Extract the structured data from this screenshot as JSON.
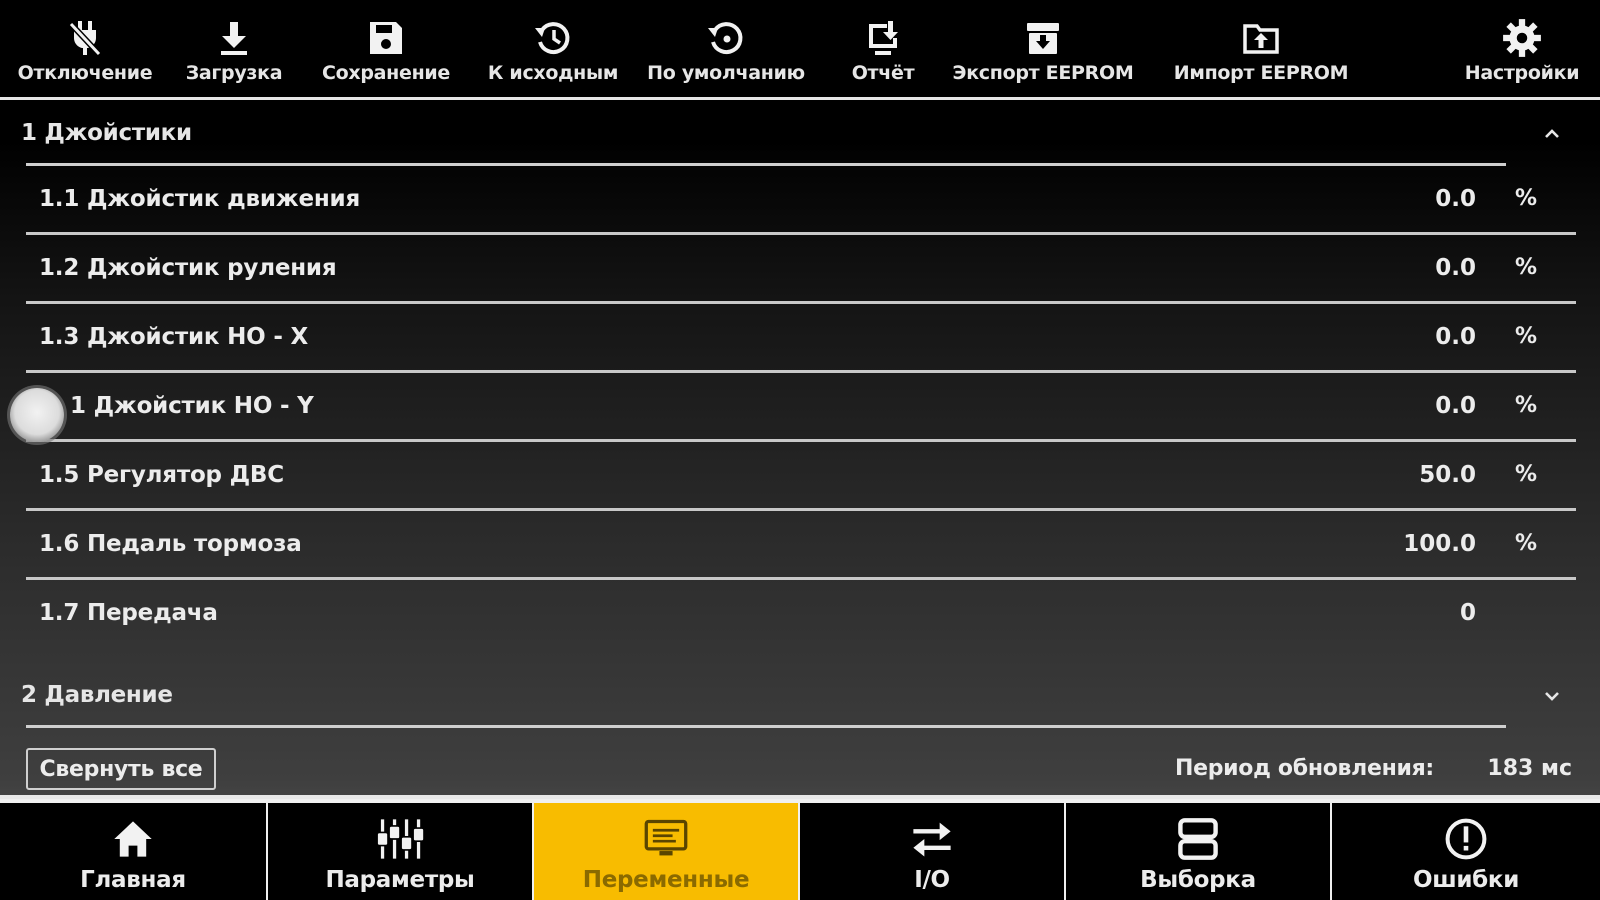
{
  "toolbar": {
    "items": [
      {
        "label": "Отключение",
        "icon": "plug-off-icon"
      },
      {
        "label": "Загрузка",
        "icon": "download-icon"
      },
      {
        "label": "Сохранение",
        "icon": "save-icon"
      },
      {
        "label": "К исходным",
        "icon": "history-icon"
      },
      {
        "label": "По умолчанию",
        "icon": "restore-icon"
      },
      {
        "label": "Отчёт",
        "icon": "report-download-icon"
      },
      {
        "label": "Экспорт EEPROM",
        "icon": "archive-export-icon"
      },
      {
        "label": "Импорт EEPROM",
        "icon": "folder-upload-icon"
      },
      {
        "label": "Настройки",
        "icon": "gear-icon"
      }
    ]
  },
  "groups": [
    {
      "title": "1 Джойстики",
      "expanded": true,
      "rows": [
        {
          "name": "1.1 Джойстик движения",
          "value": "0.0",
          "unit": "%"
        },
        {
          "name": "1.2 Джойстик руления",
          "value": "0.0",
          "unit": "%"
        },
        {
          "name": "1.3 Джойстик НО - X",
          "value": "0.0",
          "unit": "%"
        },
        {
          "name": "1 Джойстик НО - Y",
          "value": "0.0",
          "unit": "%"
        },
        {
          "name": "1.5 Регулятор ДВС",
          "value": "50.0",
          "unit": "%"
        },
        {
          "name": "1.6 Педаль тормоза",
          "value": "100.0",
          "unit": "%"
        },
        {
          "name": "1.7 Передача",
          "value": "0",
          "unit": ""
        }
      ]
    },
    {
      "title": "2 Давление",
      "expanded": false,
      "rows": []
    }
  ],
  "footer": {
    "collapse_all_label": "Свернуть все",
    "period_label": "Период обновления:",
    "period_value": "183 мс"
  },
  "bottom_nav": {
    "tabs": [
      {
        "label": "Главная",
        "icon": "home-icon",
        "active": false
      },
      {
        "label": "Параметры",
        "icon": "sliders-icon",
        "active": false
      },
      {
        "label": "Переменные",
        "icon": "monitor-icon",
        "active": true
      },
      {
        "label": "I/O",
        "icon": "swap-arrows-icon",
        "active": false
      },
      {
        "label": "Выборка",
        "icon": "storage-icon",
        "active": false
      },
      {
        "label": "Ошибки",
        "icon": "alert-circle-icon",
        "active": false
      }
    ]
  },
  "colors": {
    "accent": "#f8bc00",
    "background": "#000000",
    "text": "#ececec",
    "divider": "#c8c8c8"
  }
}
